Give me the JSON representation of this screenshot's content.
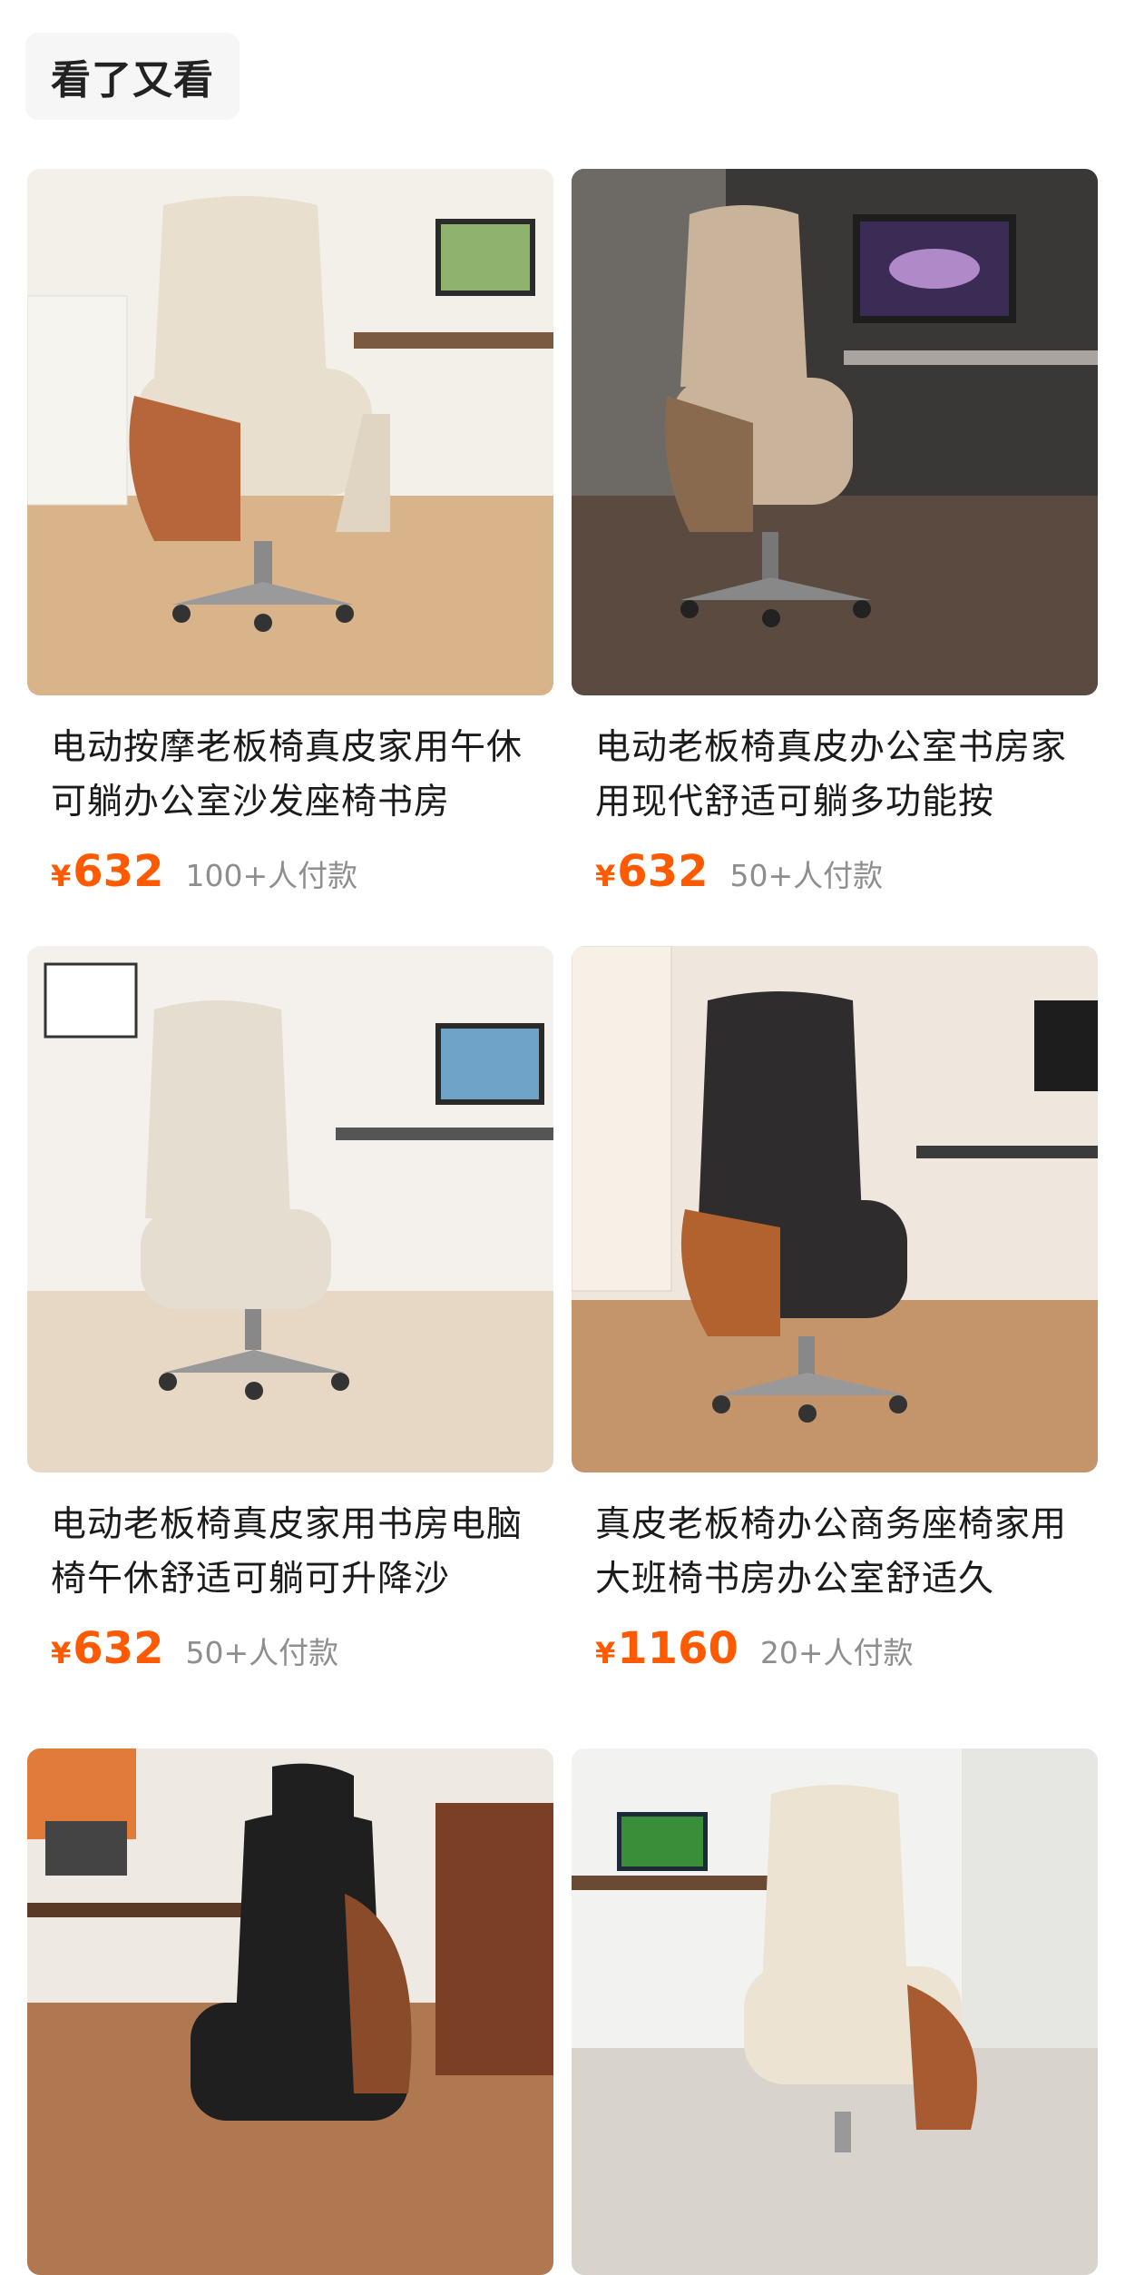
{
  "section": {
    "title": "看了又看"
  },
  "products": [
    {
      "title": "电动按摩老板椅真皮家用午休可躺办公室沙发座椅书房",
      "price_symbol": "¥",
      "price": "632",
      "sales": "100+人付款",
      "image": "chair-image",
      "colors": {
        "seat": "#e8dfcf",
        "accent": "#b7653a",
        "floor": "#d9b48a",
        "wall": "#f3f0ea"
      }
    },
    {
      "title": "电动老板椅真皮办公室书房家用现代舒适可躺多功能按",
      "price_symbol": "¥",
      "price": "632",
      "sales": "50+人付款",
      "image": "chair-image",
      "colors": {
        "seat": "#c9b39a",
        "accent": "#8a6a4f",
        "floor": "#5b4a3f",
        "wall": "#3a3837"
      }
    },
    {
      "title": "电动老板椅真皮家用书房电脑椅午休舒适可躺可升降沙",
      "price_symbol": "¥",
      "price": "632",
      "sales": "50+人付款",
      "image": "chair-image",
      "colors": {
        "seat": "#e4ddd0",
        "accent": "#cfc4b3",
        "floor": "#e6d8c4",
        "wall": "#f4f1ec"
      }
    },
    {
      "title": "真皮老板椅办公商务座椅家用大班椅书房办公室舒适久",
      "price_symbol": "¥",
      "price": "1160",
      "sales": "20+人付款",
      "image": "chair-image",
      "colors": {
        "seat": "#2e2c2d",
        "accent": "#b2622f",
        "floor": "#c4946b",
        "wall": "#efe7de"
      }
    },
    {
      "image": "chair-image",
      "colors": {
        "seat": "#1f1f1f",
        "accent": "#8a4b2a",
        "floor": "#b07850",
        "wall": "#efe9e3"
      }
    },
    {
      "image": "chair-image",
      "colors": {
        "seat": "#ece3d3",
        "accent": "#a85a30",
        "floor": "#d8d4cd",
        "wall": "#f2f2f0"
      }
    }
  ]
}
